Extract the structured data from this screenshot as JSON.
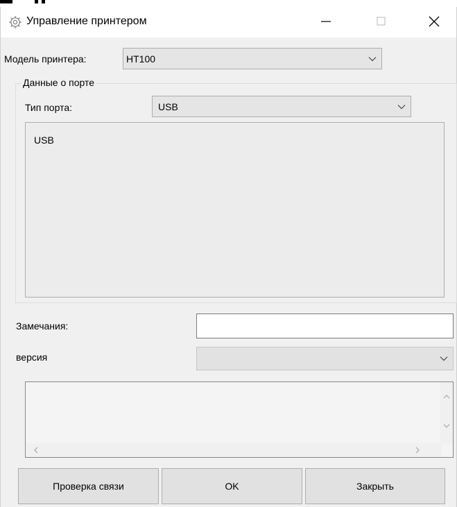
{
  "window": {
    "title": "Управление принтером",
    "minimize_glyph": "—",
    "maximize_glyph": "☐",
    "close_glyph": "✕"
  },
  "printer_model": {
    "label": "Модель принтера:",
    "value": "HT100"
  },
  "port_group": {
    "title": "Данные о порте",
    "port_type_label": "Тип порта:",
    "port_type_value": "USB",
    "panel_text": "USB"
  },
  "remarks": {
    "label": "Замечания:",
    "value": ""
  },
  "version": {
    "label": "версия",
    "value": ""
  },
  "log": {
    "text": "",
    "scroll_up": "˄",
    "scroll_down": "˅",
    "scroll_left": "<",
    "scroll_right": ">"
  },
  "buttons": {
    "check": "Проверка связи",
    "ok": "OK",
    "close": "Закрыть"
  },
  "colors": {
    "window_bg": "#f0f0f0",
    "titlebar_bg": "#ffffff",
    "control_border": "#adadad",
    "button_bg": "#e1e1e1"
  }
}
